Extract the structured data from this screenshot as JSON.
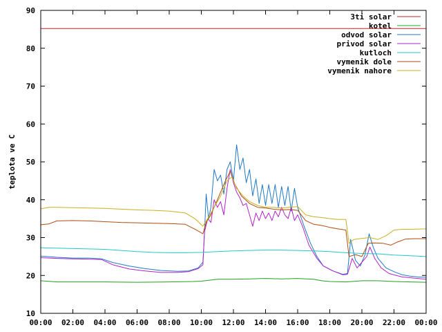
{
  "chart_data": {
    "type": "line",
    "title": "",
    "xlabel": "",
    "ylabel": "teplota ve C",
    "ylim": [
      10,
      90
    ],
    "xlim": [
      "00:00",
      "24:00"
    ],
    "grid": false,
    "legend_position": "top-right",
    "y_ticks": [
      10,
      20,
      30,
      40,
      50,
      60,
      70,
      80,
      90
    ],
    "x_ticks": [
      {
        "hour": 0,
        "label": "00:00"
      },
      {
        "hour": 2,
        "label": "02:00"
      },
      {
        "hour": 4,
        "label": "04:00"
      },
      {
        "hour": 6,
        "label": "06:00"
      },
      {
        "hour": 8,
        "label": "08:00"
      },
      {
        "hour": 10,
        "label": "10:00"
      },
      {
        "hour": 12,
        "label": "12:00"
      },
      {
        "hour": 14,
        "label": "14:00"
      },
      {
        "hour": 16,
        "label": "16:00"
      },
      {
        "hour": 18,
        "label": "18:00"
      },
      {
        "hour": 20,
        "label": "20:00"
      },
      {
        "hour": 22,
        "label": "22:00"
      },
      {
        "hour": 24,
        "label": "00:00"
      }
    ],
    "series": [
      {
        "name": "3ti solar",
        "color": "#c02020",
        "points": [
          [
            0,
            85.2
          ],
          [
            24,
            85.2
          ]
        ]
      },
      {
        "name": "kotel",
        "color": "#20a020",
        "points": [
          [
            0,
            18.6
          ],
          [
            1,
            18.3
          ],
          [
            2,
            18.3
          ],
          [
            4,
            18.3
          ],
          [
            6,
            18.2
          ],
          [
            8,
            18.3
          ],
          [
            9.5,
            18.4
          ],
          [
            10,
            18.5
          ],
          [
            11,
            19.0
          ],
          [
            12,
            19.0
          ],
          [
            13,
            19.1
          ],
          [
            14,
            19.2
          ],
          [
            15,
            19.1
          ],
          [
            16,
            19.2
          ],
          [
            17,
            19.0
          ],
          [
            17.5,
            18.6
          ],
          [
            18,
            18.4
          ],
          [
            19,
            18.3
          ],
          [
            20,
            18.6
          ],
          [
            21,
            18.6
          ],
          [
            22,
            18.4
          ],
          [
            23,
            18.3
          ],
          [
            24,
            18.2
          ]
        ]
      },
      {
        "name": "odvod solar",
        "color": "#1f78c8",
        "points": [
          [
            0,
            25.1
          ],
          [
            1,
            24.8
          ],
          [
            2,
            24.6
          ],
          [
            3,
            24.6
          ],
          [
            3.8,
            24.4
          ],
          [
            4.5,
            23.4
          ],
          [
            5.5,
            22.5
          ],
          [
            6.5,
            21.8
          ],
          [
            7.5,
            21.3
          ],
          [
            8.5,
            21.1
          ],
          [
            9.2,
            21.2
          ],
          [
            9.8,
            22.0
          ],
          [
            10.1,
            23.5
          ],
          [
            10.2,
            31.0
          ],
          [
            10.3,
            41.5
          ],
          [
            10.45,
            35.0
          ],
          [
            10.6,
            38.0
          ],
          [
            10.8,
            48.0
          ],
          [
            11.0,
            45.0
          ],
          [
            11.2,
            46.5
          ],
          [
            11.4,
            41.5
          ],
          [
            11.6,
            48.0
          ],
          [
            11.8,
            50.0
          ],
          [
            12.0,
            45.0
          ],
          [
            12.2,
            54.5
          ],
          [
            12.4,
            48.0
          ],
          [
            12.6,
            51.0
          ],
          [
            12.8,
            44.5
          ],
          [
            13.0,
            48.0
          ],
          [
            13.2,
            41.0
          ],
          [
            13.4,
            45.5
          ],
          [
            13.6,
            39.0
          ],
          [
            13.8,
            44.0
          ],
          [
            14.0,
            38.5
          ],
          [
            14.2,
            44.0
          ],
          [
            14.4,
            39.0
          ],
          [
            14.6,
            44.0
          ],
          [
            14.8,
            38.0
          ],
          [
            15.0,
            43.5
          ],
          [
            15.2,
            38.5
          ],
          [
            15.4,
            43.5
          ],
          [
            15.6,
            37.0
          ],
          [
            15.8,
            43.0
          ],
          [
            16.0,
            38.0
          ],
          [
            16.4,
            33.0
          ],
          [
            16.8,
            28.5
          ],
          [
            17.2,
            25.0
          ],
          [
            17.6,
            22.5
          ],
          [
            18.2,
            21.2
          ],
          [
            18.8,
            20.3
          ],
          [
            19.1,
            20.5
          ],
          [
            19.3,
            29.5
          ],
          [
            19.6,
            24.0
          ],
          [
            19.9,
            22.5
          ],
          [
            20.2,
            25.5
          ],
          [
            20.45,
            31.0
          ],
          [
            20.7,
            27.5
          ],
          [
            21.0,
            24.5
          ],
          [
            21.5,
            22.0
          ],
          [
            22.0,
            21.0
          ],
          [
            22.5,
            20.2
          ],
          [
            23.0,
            19.8
          ],
          [
            23.5,
            19.6
          ],
          [
            24.0,
            19.5
          ]
        ]
      },
      {
        "name": "privod solar",
        "color": "#b020c8",
        "points": [
          [
            0,
            24.7
          ],
          [
            1,
            24.5
          ],
          [
            2,
            24.4
          ],
          [
            3,
            24.3
          ],
          [
            3.8,
            24.2
          ],
          [
            4.5,
            22.8
          ],
          [
            5.5,
            21.7
          ],
          [
            6.5,
            21.2
          ],
          [
            7.5,
            20.8
          ],
          [
            8.5,
            20.8
          ],
          [
            9.2,
            21.0
          ],
          [
            9.8,
            21.8
          ],
          [
            10.1,
            22.8
          ],
          [
            10.2,
            31.5
          ],
          [
            10.4,
            35.0
          ],
          [
            10.6,
            34.0
          ],
          [
            10.8,
            40.0
          ],
          [
            11.0,
            38.0
          ],
          [
            11.2,
            39.5
          ],
          [
            11.4,
            36.0
          ],
          [
            11.6,
            43.0
          ],
          [
            11.8,
            48.0
          ],
          [
            12.0,
            44.5
          ],
          [
            12.2,
            42.0
          ],
          [
            12.4,
            40.5
          ],
          [
            12.6,
            38.5
          ],
          [
            12.8,
            39.0
          ],
          [
            13.0,
            36.0
          ],
          [
            13.2,
            33.0
          ],
          [
            13.4,
            36.5
          ],
          [
            13.6,
            34.5
          ],
          [
            13.8,
            37.0
          ],
          [
            14.0,
            35.0
          ],
          [
            14.2,
            36.5
          ],
          [
            14.4,
            34.5
          ],
          [
            14.6,
            37.0
          ],
          [
            14.8,
            35.5
          ],
          [
            15.0,
            38.0
          ],
          [
            15.2,
            36.0
          ],
          [
            15.4,
            35.0
          ],
          [
            15.6,
            38.0
          ],
          [
            15.8,
            34.5
          ],
          [
            16.0,
            36.0
          ],
          [
            16.3,
            33.0
          ],
          [
            16.7,
            28.0
          ],
          [
            17.2,
            24.5
          ],
          [
            17.6,
            22.5
          ],
          [
            18.2,
            21.2
          ],
          [
            18.8,
            20.2
          ],
          [
            19.1,
            20.3
          ],
          [
            19.4,
            24.5
          ],
          [
            19.7,
            22.0
          ],
          [
            20.0,
            23.5
          ],
          [
            20.3,
            25.0
          ],
          [
            20.5,
            27.5
          ],
          [
            20.8,
            24.5
          ],
          [
            21.2,
            22.0
          ],
          [
            21.7,
            20.5
          ],
          [
            22.5,
            19.6
          ],
          [
            23.5,
            19.2
          ],
          [
            24.0,
            19.0
          ]
        ]
      },
      {
        "name": "kutloch",
        "color": "#20c8c8",
        "points": [
          [
            0,
            27.3
          ],
          [
            1,
            27.2
          ],
          [
            2,
            27.1
          ],
          [
            3,
            27.0
          ],
          [
            4,
            26.9
          ],
          [
            5,
            26.6
          ],
          [
            6,
            26.3
          ],
          [
            7,
            26.1
          ],
          [
            8,
            26.0
          ],
          [
            9,
            26.0
          ],
          [
            10,
            26.1
          ],
          [
            11,
            26.3
          ],
          [
            12,
            26.5
          ],
          [
            13,
            26.6
          ],
          [
            14,
            26.7
          ],
          [
            15,
            26.7
          ],
          [
            16,
            26.6
          ],
          [
            17,
            26.5
          ],
          [
            18,
            26.3
          ],
          [
            19,
            26.0
          ],
          [
            20,
            25.8
          ],
          [
            21,
            25.7
          ],
          [
            22,
            25.4
          ],
          [
            23,
            25.2
          ],
          [
            24,
            25.0
          ]
        ]
      },
      {
        "name": "vymenik dole",
        "color": "#b04a10",
        "points": [
          [
            0,
            33.4
          ],
          [
            0.5,
            33.6
          ],
          [
            1,
            34.4
          ],
          [
            2,
            34.5
          ],
          [
            3,
            34.4
          ],
          [
            4,
            34.2
          ],
          [
            5,
            34.0
          ],
          [
            6,
            33.9
          ],
          [
            7,
            33.8
          ],
          [
            8,
            33.7
          ],
          [
            9,
            33.5
          ],
          [
            9.7,
            32.0
          ],
          [
            10.1,
            31.0
          ],
          [
            10.3,
            34.0
          ],
          [
            10.6,
            36.0
          ],
          [
            11.0,
            40.0
          ],
          [
            11.5,
            45.0
          ],
          [
            11.8,
            47.5
          ],
          [
            12.1,
            44.0
          ],
          [
            12.5,
            41.0
          ],
          [
            13.0,
            39.0
          ],
          [
            13.5,
            38.0
          ],
          [
            14.0,
            37.8
          ],
          [
            14.5,
            37.5
          ],
          [
            15.0,
            37.3
          ],
          [
            15.5,
            37.4
          ],
          [
            16.0,
            37.2
          ],
          [
            16.5,
            34.5
          ],
          [
            17.0,
            33.5
          ],
          [
            17.5,
            33.2
          ],
          [
            18.0,
            32.7
          ],
          [
            18.5,
            32.3
          ],
          [
            19.0,
            32.0
          ],
          [
            19.2,
            25.0
          ],
          [
            19.6,
            25.5
          ],
          [
            20.0,
            25.0
          ],
          [
            20.4,
            28.5
          ],
          [
            20.8,
            28.6
          ],
          [
            21.3,
            28.5
          ],
          [
            21.8,
            28.0
          ],
          [
            22.2,
            28.8
          ],
          [
            22.7,
            29.6
          ],
          [
            23.2,
            29.7
          ],
          [
            24.0,
            29.7
          ]
        ]
      },
      {
        "name": "vymenik nahore",
        "color": "#c8b020",
        "points": [
          [
            0,
            37.6
          ],
          [
            0.5,
            38.0
          ],
          [
            1,
            38.0
          ],
          [
            2,
            37.9
          ],
          [
            3,
            37.8
          ],
          [
            4,
            37.7
          ],
          [
            5,
            37.5
          ],
          [
            6,
            37.3
          ],
          [
            7,
            37.2
          ],
          [
            8,
            37.0
          ],
          [
            9,
            36.5
          ],
          [
            9.6,
            35.0
          ],
          [
            10.1,
            33.0
          ],
          [
            10.4,
            35.0
          ],
          [
            10.8,
            38.0
          ],
          [
            11.2,
            41.0
          ],
          [
            11.6,
            45.0
          ],
          [
            11.9,
            46.0
          ],
          [
            12.2,
            43.0
          ],
          [
            12.6,
            41.0
          ],
          [
            13.0,
            39.5
          ],
          [
            13.5,
            38.5
          ],
          [
            14.0,
            38.0
          ],
          [
            14.5,
            38.0
          ],
          [
            15.0,
            37.8
          ],
          [
            15.5,
            38.0
          ],
          [
            16.0,
            38.2
          ],
          [
            16.5,
            36.0
          ],
          [
            17.0,
            35.5
          ],
          [
            17.5,
            35.3
          ],
          [
            18.0,
            35.0
          ],
          [
            18.5,
            34.8
          ],
          [
            19.0,
            34.8
          ],
          [
            19.2,
            28.5
          ],
          [
            19.5,
            29.5
          ],
          [
            20.0,
            29.8
          ],
          [
            20.5,
            30.0
          ],
          [
            21.0,
            29.5
          ],
          [
            21.5,
            30.5
          ],
          [
            22.0,
            32.0
          ],
          [
            22.5,
            32.2
          ],
          [
            23.0,
            32.2
          ],
          [
            24.0,
            32.3
          ]
        ]
      }
    ]
  }
}
